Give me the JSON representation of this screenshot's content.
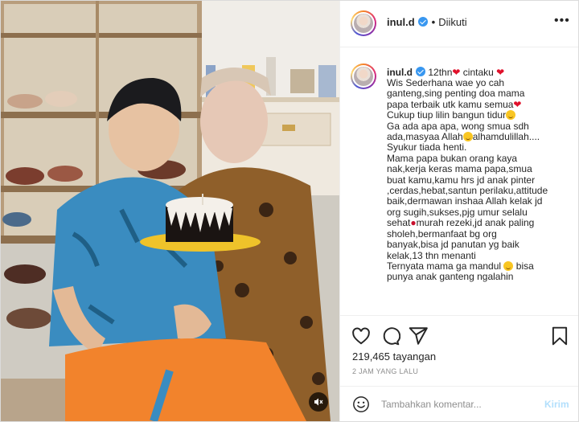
{
  "post": {
    "username": "inul.d",
    "follow_status": "Diikuti",
    "more_glyph": "•••"
  },
  "caption": {
    "username": "inul.d",
    "head_text_1": "12thn",
    "head_text_2": "cintaku",
    "lines": [
      "Wis Sederhana wae yo cah",
      "ganteng,sing penting doa mama",
      "papa terbaik utk kamu semua",
      "Cukup tiup lilin bangun tidur",
      "Ga ada apa apa, wong smua sdh",
      "ada,masyaa Allah",
      "alhamdulillah....",
      "Syukur tiada henti.",
      "Mama papa bukan orang kaya",
      "nak,kerja keras mama papa,smua",
      "buat kamu,kamu hrs jd anak pinter",
      ",cerdas,hebat,santun perilaku,attitude",
      "baik,dermawan inshaa Allah kelak jd",
      "org sugih,sukses,pjg umur selalu",
      "sehat",
      "murah rezeki,jd anak paling",
      "sholeh,bermanfaat bg org",
      "banyak,bisa jd panutan yg baik",
      "kelak,13 thn menanti",
      "Ternyata mama ga mandul",
      "bisa",
      "punya anak ganteng ngalahin"
    ]
  },
  "stats": {
    "views": "219,465 tayangan",
    "time_ago": "2 JAM YANG LALU"
  },
  "comment": {
    "placeholder": "Tambahkan komentar...",
    "send_label": "Kirim"
  },
  "icons": {
    "like": "heart-icon",
    "comment": "comment-icon",
    "share": "share-icon",
    "save": "bookmark-icon",
    "emoji": "emoji-icon",
    "mute": "speaker-muted-icon"
  },
  "colors": {
    "verified": "#3897f0",
    "heart": "#e0112b",
    "send_disabled": "#b2dffc",
    "muted_text": "#8e8e8e"
  }
}
